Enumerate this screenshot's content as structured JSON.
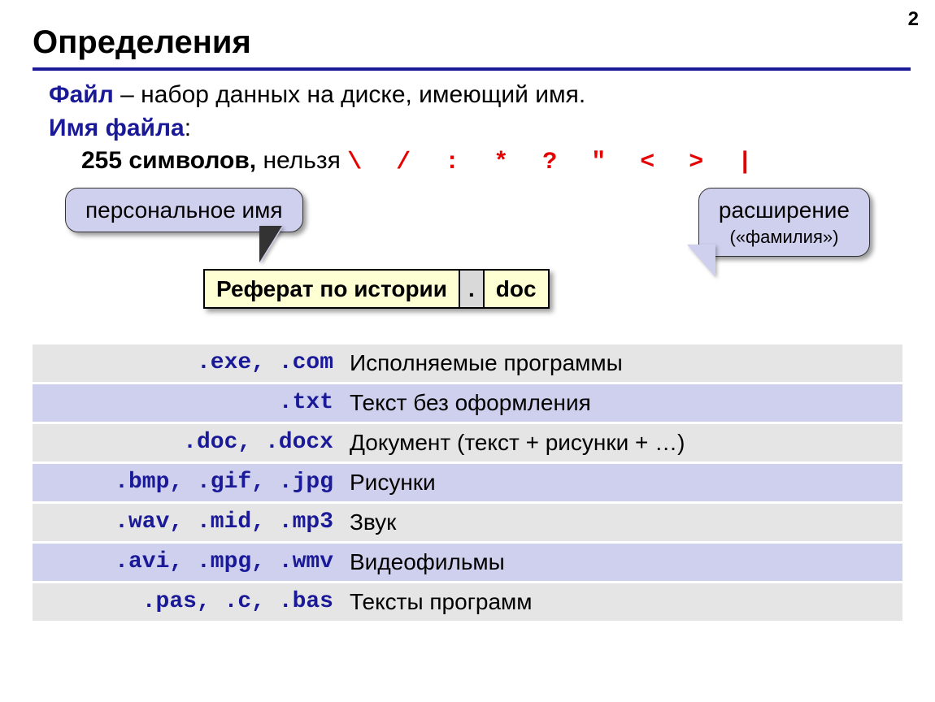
{
  "page_number": "2",
  "title": "Определения",
  "def": {
    "term1": "Файл",
    "def1": " – набор данных на диске, имеющий имя.",
    "term2": "Имя файла",
    "colon": ":",
    "limit_bold": "255 символов,",
    "limit_rest": " нельзя ",
    "forbidden": "\\ / : * ? \" < > |"
  },
  "callout": {
    "left": "персональное имя",
    "right": "расширение",
    "right_sub": "(«фамилия»)"
  },
  "filename": {
    "name": "Реферат по истории",
    "dot": ".",
    "ext": "doc"
  },
  "ext_rows": [
    {
      "ext": ".exe, .com",
      "desc": "Исполняемые программы"
    },
    {
      "ext": ".txt",
      "desc": "Текст без оформления"
    },
    {
      "ext": ".doc, .docx",
      "desc": "Документ (текст + рисунки + …)"
    },
    {
      "ext": ".bmp, .gif, .jpg",
      "desc": "Рисунки"
    },
    {
      "ext": ".wav, .mid, .mp3",
      "desc": "Звук"
    },
    {
      "ext": ".avi, .mpg, .wmv",
      "desc": "Видеофильмы"
    },
    {
      "ext": ".pas, .c, .bas",
      "desc": "Тексты программ"
    }
  ]
}
